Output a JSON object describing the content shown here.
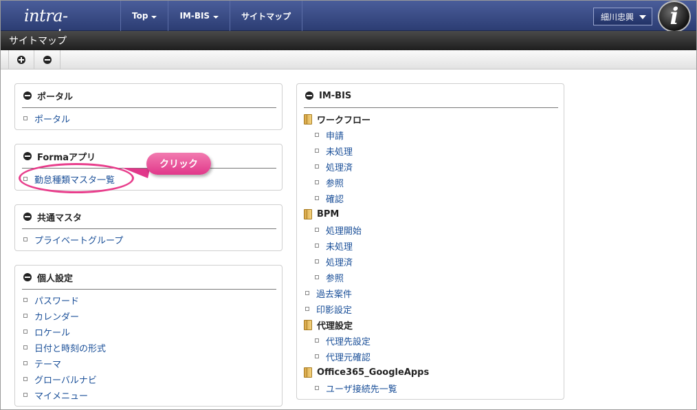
{
  "header": {
    "logo_text": "intra-mart",
    "nav": [
      {
        "label": "Top",
        "dropdown": true
      },
      {
        "label": "IM-BIS",
        "dropdown": true
      },
      {
        "label": "サイトマップ",
        "dropdown": false
      }
    ],
    "user_name": "細川忠興"
  },
  "page": {
    "title": "サイトマップ"
  },
  "toolbar": {
    "expand_icon": "plus-circle-icon",
    "collapse_icon": "minus-circle-icon"
  },
  "left_panels": [
    {
      "title": "ポータル",
      "items": [
        "ポータル"
      ]
    },
    {
      "title": "Formaアプリ",
      "items": [
        "勤怠種類マスタ一覧"
      ]
    },
    {
      "title": "共通マスタ",
      "items": [
        "プライベートグループ"
      ]
    },
    {
      "title": "個人設定",
      "items": [
        "パスワード",
        "カレンダー",
        "ロケール",
        "日付と時刻の形式",
        "テーマ",
        "グローバルナビ",
        "マイメニュー"
      ]
    }
  ],
  "right_panel": {
    "title": "IM-BIS",
    "entries": [
      {
        "type": "folder",
        "label": "ワークフロー"
      },
      {
        "type": "item",
        "label": "申請"
      },
      {
        "type": "item",
        "label": "未処理"
      },
      {
        "type": "item",
        "label": "処理済"
      },
      {
        "type": "item",
        "label": "参照"
      },
      {
        "type": "item",
        "label": "確認"
      },
      {
        "type": "folder",
        "label": "BPM"
      },
      {
        "type": "item",
        "label": "処理開始"
      },
      {
        "type": "item",
        "label": "未処理"
      },
      {
        "type": "item",
        "label": "処理済"
      },
      {
        "type": "item",
        "label": "参照"
      },
      {
        "type": "toplink",
        "label": "過去案件"
      },
      {
        "type": "toplink",
        "label": "印影設定"
      },
      {
        "type": "folder",
        "label": "代理設定"
      },
      {
        "type": "item",
        "label": "代理先設定"
      },
      {
        "type": "item",
        "label": "代理元確認"
      },
      {
        "type": "folder",
        "label": "Office365_GoogleApps"
      },
      {
        "type": "item",
        "label": "ユーザ接続先一覧"
      }
    ]
  },
  "annotation": {
    "label": "クリック",
    "color": "#e83e8c"
  }
}
